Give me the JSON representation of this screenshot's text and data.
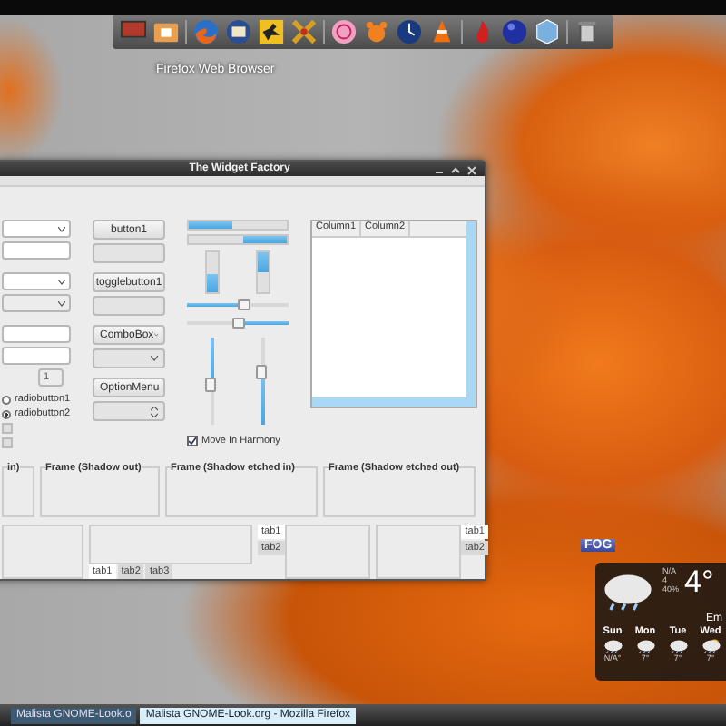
{
  "dock": {
    "tooltip": "Firefox Web Browser"
  },
  "window": {
    "title": "The Widget Factory",
    "column_1": {
      "spin_value": "1",
      "radios": [
        {
          "label": "radiobutton1",
          "selected": false
        },
        {
          "label": "radiobutton2",
          "selected": true
        }
      ],
      "checks": [
        {
          "checked": false,
          "disabled": true
        },
        {
          "checked": false,
          "disabled": true
        }
      ]
    },
    "column_2": [
      {
        "kind": "button",
        "label": "button1",
        "disabled": false
      },
      {
        "kind": "button",
        "disabled": true
      },
      {
        "kind": "button",
        "label": "togglebutton1",
        "disabled": false
      },
      {
        "kind": "button",
        "disabled": true
      },
      {
        "kind": "combo",
        "label": "ComboBox",
        "disabled": false
      },
      {
        "kind": "combo",
        "disabled": true
      },
      {
        "kind": "option",
        "label": "OptionMenu",
        "disabled": false
      },
      {
        "kind": "option",
        "disabled": true
      }
    ],
    "progress_h": [
      {
        "level": 0.45,
        "inverted": false
      },
      {
        "level": 0.45,
        "inverted": true
      }
    ],
    "progress_v": [
      {
        "level": 0.45,
        "inverted": false
      },
      {
        "level": 0.5,
        "inverted": true
      }
    ],
    "sliders_h": [
      {
        "level": 0.55,
        "inverted": false
      },
      {
        "level": 0.5,
        "inverted": true
      }
    ],
    "sliders_v": [
      {
        "level": 0.55,
        "inverted": true
      },
      {
        "level": 0.6,
        "inverted": false
      }
    ],
    "harmony": {
      "label": "Move In Harmony",
      "checked": true
    },
    "tree": {
      "columns": [
        "Column1",
        "Column2"
      ]
    },
    "frames": [
      "in)",
      "Frame (Shadow out)",
      "Frame (Shadow etched in)",
      "Frame (Shadow etched out)"
    ],
    "notebooks": [
      {
        "kind": "bottom",
        "tabs": [
          {
            "label": "tab1",
            "selected": true
          },
          {
            "label": "tab2",
            "selected": false
          },
          {
            "label": "tab3",
            "selected": false
          }
        ]
      },
      {
        "kind": "left",
        "tabs": [
          {
            "label": "tab1",
            "selected": true
          },
          {
            "label": "tab2",
            "selected": false
          }
        ]
      },
      {
        "kind": "right",
        "tabs": [
          {
            "label": "tab1",
            "selected": true
          },
          {
            "label": "tab2",
            "selected": false
          }
        ]
      }
    ]
  },
  "weather": {
    "label": "FOG",
    "details": [
      "N/A",
      "4",
      "40%"
    ],
    "temperature": "4°",
    "partial": "Em",
    "days": [
      {
        "name": "Sun",
        "temp": "N/A°"
      },
      {
        "name": "Mon",
        "temp": "7°"
      },
      {
        "name": "Tue",
        "temp": "7°"
      },
      {
        "name": "Wed",
        "temp": "7°"
      }
    ]
  },
  "taskbar": [
    {
      "label": "Malista GNOME-Look.o",
      "selected": false
    },
    {
      "label": "Malista GNOME-Look.org - Mozilla Firefox",
      "selected": true
    }
  ]
}
